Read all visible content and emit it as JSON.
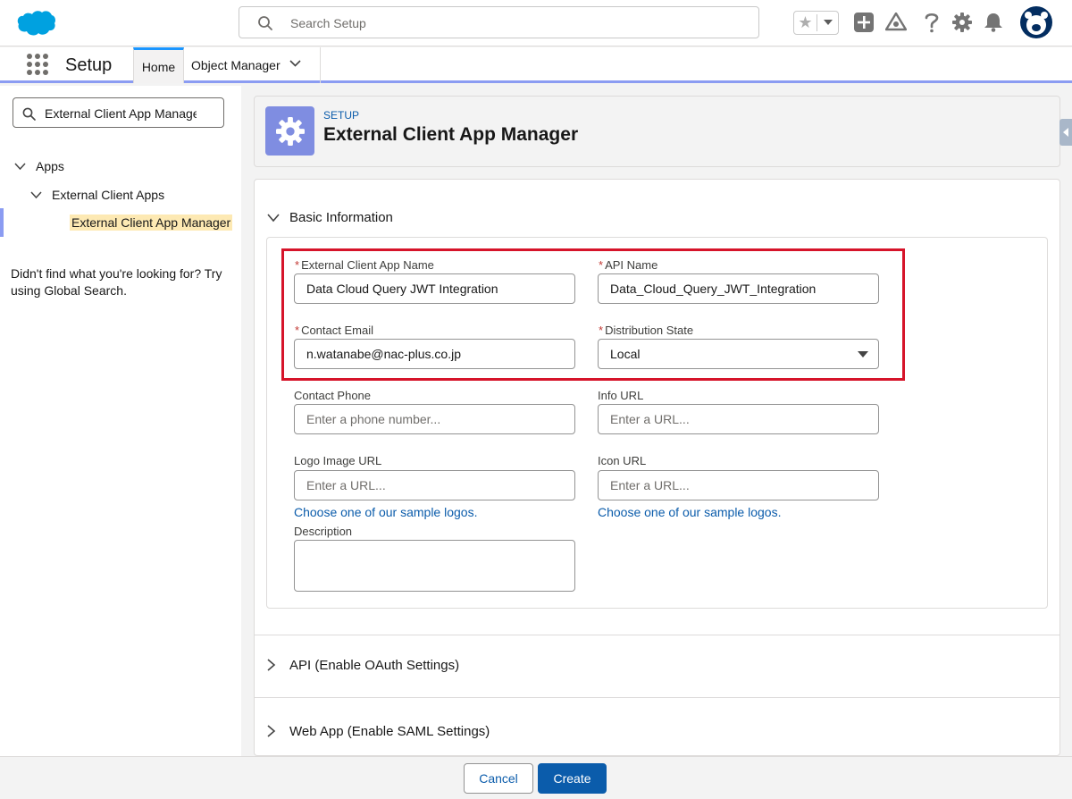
{
  "header": {
    "search_placeholder": "Search Setup",
    "icons": [
      "salesforce-logo",
      "favorites-star-icon",
      "chevron-down-icon",
      "add-icon",
      "trailhead-icon",
      "help-icon",
      "gear-icon",
      "bell-icon",
      "avatar"
    ]
  },
  "nav": {
    "app_name": "Setup",
    "tabs": [
      {
        "label": "Home",
        "active": true
      },
      {
        "label": "Object Manager",
        "active": false
      }
    ]
  },
  "sidebar": {
    "quickfind_value": "External Client App Manager",
    "tree": [
      {
        "label": "Apps",
        "level": 0,
        "expanded": true
      },
      {
        "label": "External Client Apps",
        "level": 1,
        "expanded": true
      },
      {
        "label": "External Client App Manager",
        "level": 2,
        "selected": true
      }
    ],
    "not_found_text": "Didn't find what you're looking for? Try using Global Search."
  },
  "page": {
    "eyebrow": "SETUP",
    "title": "External Client App Manager"
  },
  "form": {
    "section_basic": "Basic Information",
    "fields": {
      "app_name": {
        "label": "External Client App Name",
        "required": true,
        "value": "Data Cloud Query JWT Integration"
      },
      "api_name": {
        "label": "API Name",
        "required": true,
        "value": "Data_Cloud_Query_JWT_Integration"
      },
      "contact_email": {
        "label": "Contact Email",
        "required": true,
        "value": "n.watanabe@nac-plus.co.jp"
      },
      "distribution_state": {
        "label": "Distribution State",
        "required": true,
        "value": "Local"
      },
      "contact_phone": {
        "label": "Contact Phone",
        "placeholder": "Enter a phone number..."
      },
      "info_url": {
        "label": "Info URL",
        "placeholder": "Enter a URL..."
      },
      "logo_url": {
        "label": "Logo Image URL",
        "placeholder": "Enter a URL...",
        "link": "Choose one of our sample logos."
      },
      "icon_url": {
        "label": "Icon URL",
        "placeholder": "Enter a URL...",
        "link": "Choose one of our sample logos."
      },
      "description": {
        "label": "Description",
        "value": ""
      }
    },
    "section_api": "API (Enable OAuth Settings)",
    "section_web": "Web App (Enable SAML Settings)"
  },
  "footer": {
    "cancel_label": "Cancel",
    "create_label": "Create"
  },
  "colors": {
    "brand_blue": "#0b5cab",
    "setup_icon_bg": "#7f8de1",
    "required_red": "#c23934",
    "highlight_red": "#d6142a",
    "selected_highlight": "#fde9b3"
  }
}
